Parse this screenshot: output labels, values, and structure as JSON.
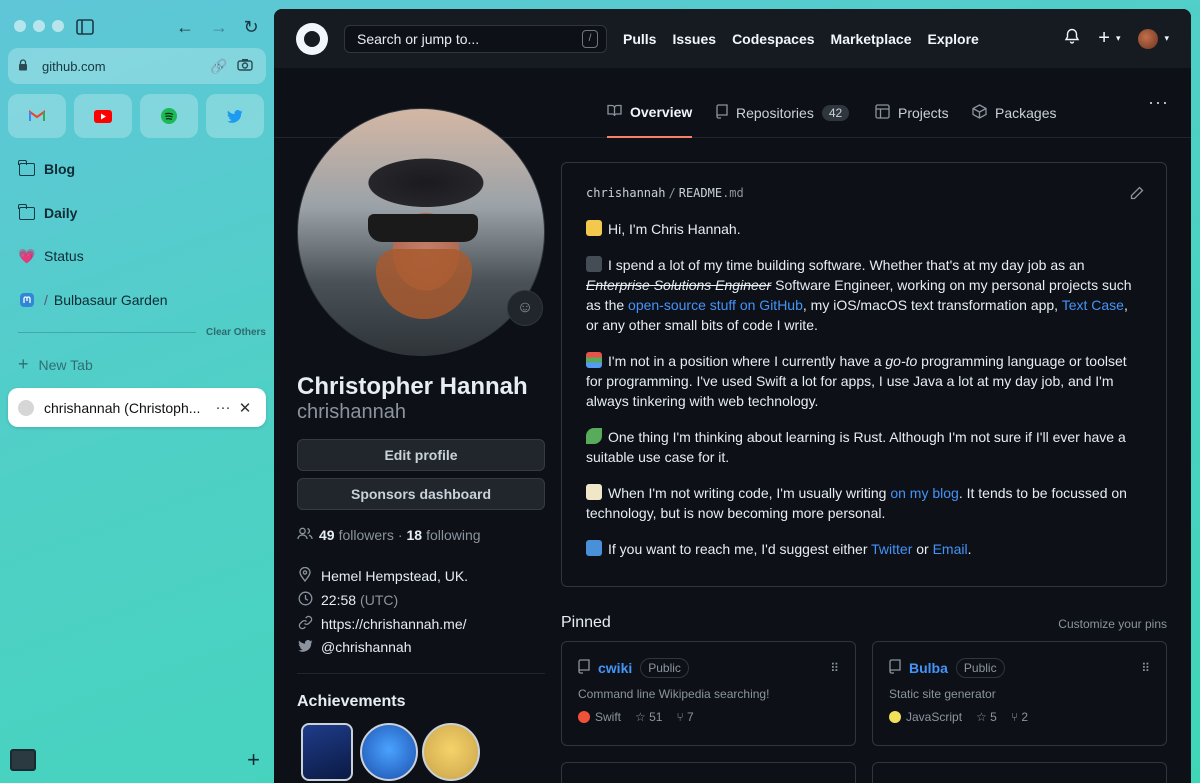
{
  "browser": {
    "url": "github.com",
    "favorites": [
      {
        "name": "gmail-icon",
        "color": "#ea4335"
      },
      {
        "name": "youtube-icon",
        "color": "#ff0000"
      },
      {
        "name": "spotify-icon",
        "color": "#1db954"
      },
      {
        "name": "twitter-icon",
        "color": "#1d9bf0"
      }
    ],
    "pinned_items": [
      "Blog",
      "Daily",
      "Status",
      "Bulbasaur Garden"
    ],
    "clear_others": "Clear Others",
    "new_tab": "New Tab",
    "active_tab": "chrishannah (Christoph..."
  },
  "github": {
    "search_placeholder": "Search or jump to...",
    "search_key": "/",
    "nav": [
      "Pulls",
      "Issues",
      "Codespaces",
      "Marketplace",
      "Explore"
    ],
    "tabs": {
      "overview": "Overview",
      "repositories": "Repositories",
      "repositories_count": "42",
      "projects": "Projects",
      "packages": "Packages"
    },
    "profile": {
      "full_name": "Christopher Hannah",
      "login": "chrishannah",
      "edit_profile": "Edit profile",
      "sponsors_dashboard": "Sponsors dashboard",
      "followers_count": "49",
      "followers_label": "followers",
      "dot": "·",
      "following_count": "18",
      "following_label": "following",
      "location": "Hemel Hempstead, UK.",
      "time": "22:58",
      "timezone": "(UTC)",
      "website": "https://chrishannah.me/",
      "twitter": "@chrishannah",
      "achievements_title": "Achievements"
    },
    "readme": {
      "owner": "chrishannah",
      "sep": "/",
      "file": "README",
      "ext": ".md",
      "p1": "Hi, I'm Chris Hannah.",
      "p2_a": "I spend a lot of my time building software. Whether that's at my day job as an ",
      "p2_strike": "Enterprise Solutions Engineer",
      "p2_b": " Software Engineer, working on my personal projects such as the ",
      "p2_link1": "open-source stuff on GitHub",
      "p2_c": ", my iOS/macOS text transformation app, ",
      "p2_link2": "Text Case",
      "p2_d": ", or any other small bits of code I write.",
      "p3_a": "I'm not in a position where I currently have a ",
      "p3_em": "go-to",
      "p3_b": " programming language or toolset for programming. I've used Swift a lot for apps, I use Java a lot at my day job, and I'm always tinkering with web technology.",
      "p4": "One thing I'm thinking about learning is Rust. Although I'm not sure if I'll ever have a suitable use case for it.",
      "p5_a": "When I'm not writing code, I'm usually writing ",
      "p5_link": "on my blog",
      "p5_b": ". It tends to be focussed on technology, but is now becoming more personal.",
      "p6_a": "If you want to reach me, I'd suggest either ",
      "p6_link1": "Twitter",
      "p6_b": " or ",
      "p6_link2": "Email",
      "p6_c": "."
    },
    "pinned": {
      "title": "Pinned",
      "customize": "Customize your pins",
      "repos": [
        {
          "name": "cwiki",
          "visibility": "Public",
          "description": "Command line Wikipedia searching!",
          "language": "Swift",
          "lang_color": "#f05138",
          "stars": "51",
          "forks": "7"
        },
        {
          "name": "Bulba",
          "visibility": "Public",
          "description": "Static site generator",
          "language": "JavaScript",
          "lang_color": "#f1e05a",
          "stars": "5",
          "forks": "2"
        }
      ]
    }
  }
}
